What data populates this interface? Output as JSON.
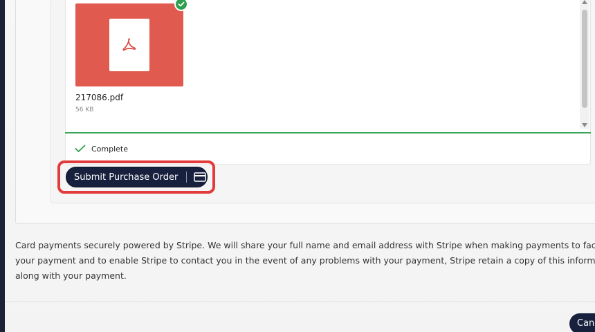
{
  "upload": {
    "file": {
      "name": "217086.pdf",
      "size": "56 KB",
      "icon": "pdf-icon",
      "thumb_color": "#e05a4f"
    },
    "status": {
      "text": "Complete",
      "color": "#3aa65a"
    }
  },
  "actions": {
    "submit_label": "Submit Purchase Order",
    "submit_icon": "credit-card-icon",
    "cancel_label": "Canc"
  },
  "footer": {
    "lines": [
      "Card payments securely powered by Stripe. We will share your full name and email address with Stripe when making payments to facilita",
      "your payment and to enable Stripe to contact you in the event of any problems with your payment, Stripe retain a copy of this informatio",
      "along with your payment."
    ]
  },
  "colors": {
    "primary_button": "#17213d",
    "highlight": "#e23b3b",
    "success": "#2e9e4f"
  }
}
